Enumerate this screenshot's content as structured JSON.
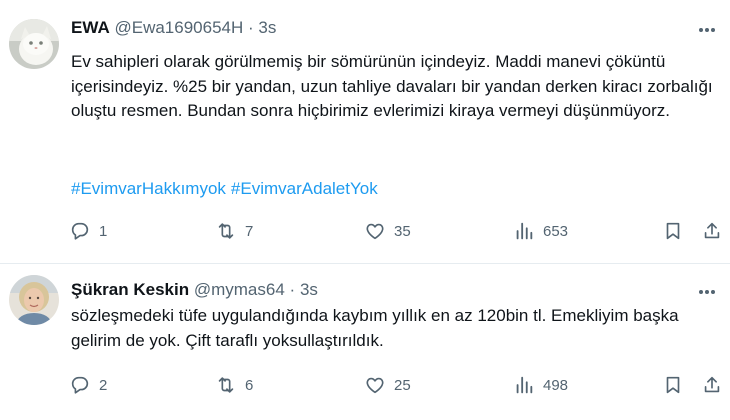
{
  "tweets": [
    {
      "author_name": "EWA",
      "handle": "@Ewa1690654H",
      "separator": "·",
      "time": "3s",
      "text": "Ev sahipleri olarak görülmemiş bir sömürünün içindeyiz. Maddi manevi çöküntü içerisindeyiz. %25 bir yandan, uzun tahliye davaları bir yandan derken kiracı zorbalığı oluştu resmen. Bundan sonra hiçbirimiz evlerimizi kiraya vermeyi düşünmüyorz.",
      "hashtags": [
        "#EvimvarHakkımyok",
        "#EvimvarAdaletYok"
      ],
      "replies": "1",
      "retweets": "7",
      "likes": "35",
      "views": "653",
      "avatar_icon": "white-cat-avatar"
    },
    {
      "author_name": "Şükran Keskin",
      "handle": "@mymas64",
      "separator": "·",
      "time": "3s",
      "text": "sözleşmedeki tüfe uygulandığında kaybım yıllık en az 120bin tl. Emekliyim başka gelirim de yok. Çift taraflı yoksullaştırıldık.",
      "replies": "2",
      "retweets": "6",
      "likes": "25",
      "views": "498",
      "avatar_icon": "woman-portrait-avatar"
    }
  ],
  "colors": {
    "text": "#0f1419",
    "muted": "#536471",
    "link": "#1d9bf0",
    "divider": "#e6ecf0"
  }
}
